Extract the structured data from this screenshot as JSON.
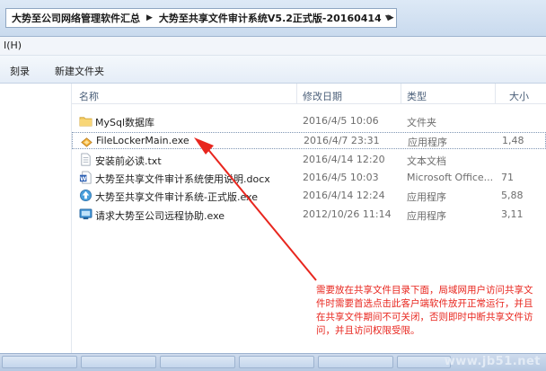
{
  "address_bar": {
    "crumbs": [
      "大势至公司网络管理软件汇总",
      "大势至共享文件审计系统V5.2正式版-20160414"
    ]
  },
  "menubar": {
    "help_label": "I(H)"
  },
  "toolbar": {
    "burn_label": "刻录",
    "new_folder_label": "新建文件夹"
  },
  "columns": {
    "name": "名称",
    "date": "修改日期",
    "type": "类型",
    "size": "大小"
  },
  "files": [
    {
      "name": "MySql数据库",
      "date": "2016/4/5 10:06",
      "type": "文件夹",
      "size": "",
      "icon": "folder-icon"
    },
    {
      "name": "FileLockerMain.exe",
      "date": "2016/4/7 23:31",
      "type": "应用程序",
      "size": "1,48",
      "icon": "exe-icon"
    },
    {
      "name": "安装前必读.txt",
      "date": "2016/4/14 12:20",
      "type": "文本文档",
      "size": "",
      "icon": "text-file-icon"
    },
    {
      "name": "大势至共享文件审计系统使用说明.docx",
      "date": "2016/4/5 10:03",
      "type": "Microsoft Office...",
      "size": "71",
      "icon": "word-doc-icon"
    },
    {
      "name": "大势至共享文件审计系统-正式版.exe",
      "date": "2016/4/14 12:24",
      "type": "应用程序",
      "size": "5,88",
      "icon": "installer-icon"
    },
    {
      "name": "请求大势至公司远程协助.exe",
      "date": "2012/10/26 11:14",
      "type": "应用程序",
      "size": "3,11",
      "icon": "remote-help-icon"
    }
  ],
  "annotation": {
    "text": "需要放在共享文件目录下面，局域网用户访问共享文件时需要首选点击此客户端软件放开正常运行，并且在共享文件期间不可关闭，否则即时中断共享文件访问，并且访问权限受限。",
    "color": "#e8261e"
  },
  "watermark": "www.jb51.net"
}
